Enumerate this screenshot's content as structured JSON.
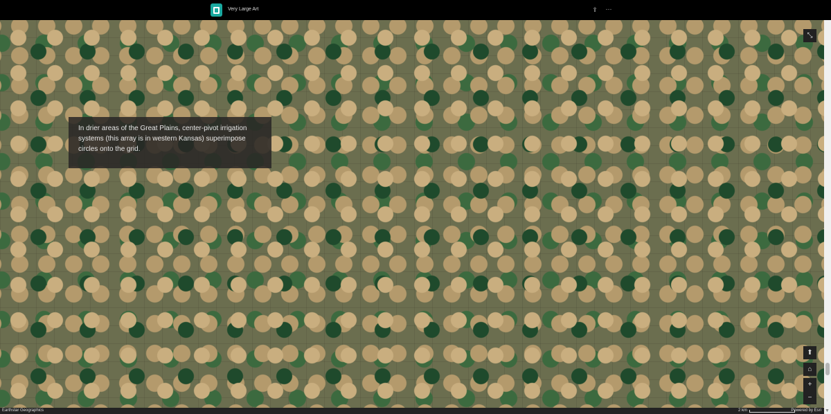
{
  "header": {
    "title": "Very Large Art",
    "share_icon": "share-icon",
    "more_icon": "more-icon"
  },
  "caption": "In drier areas of the Great Plains, center-pivot irrigation systems (this array is in western Kansas) superimpose circles onto the grid.",
  "controls": {
    "zoom_in": "+",
    "zoom_out": "−"
  },
  "footer": {
    "attribution": "Earthstar Geographics",
    "scale": "2 km",
    "powered": "Powered by Esri"
  }
}
